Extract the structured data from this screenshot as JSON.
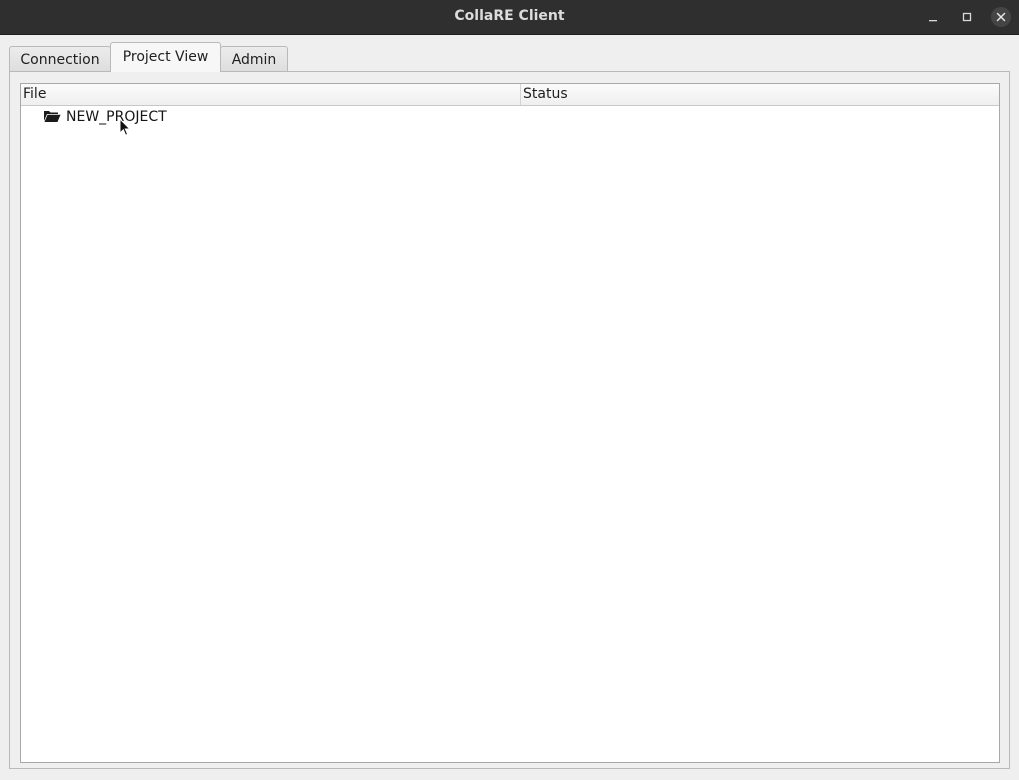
{
  "window": {
    "title": "CollaRE Client"
  },
  "tabs": [
    {
      "label": "Connection",
      "active": false
    },
    {
      "label": "Project View",
      "active": true
    },
    {
      "label": "Admin",
      "active": false
    }
  ],
  "tree": {
    "columns": [
      "File",
      "Status"
    ],
    "rows": [
      {
        "name": "NEW_PROJECT",
        "status": "",
        "icon": "folder-open-icon"
      }
    ]
  }
}
